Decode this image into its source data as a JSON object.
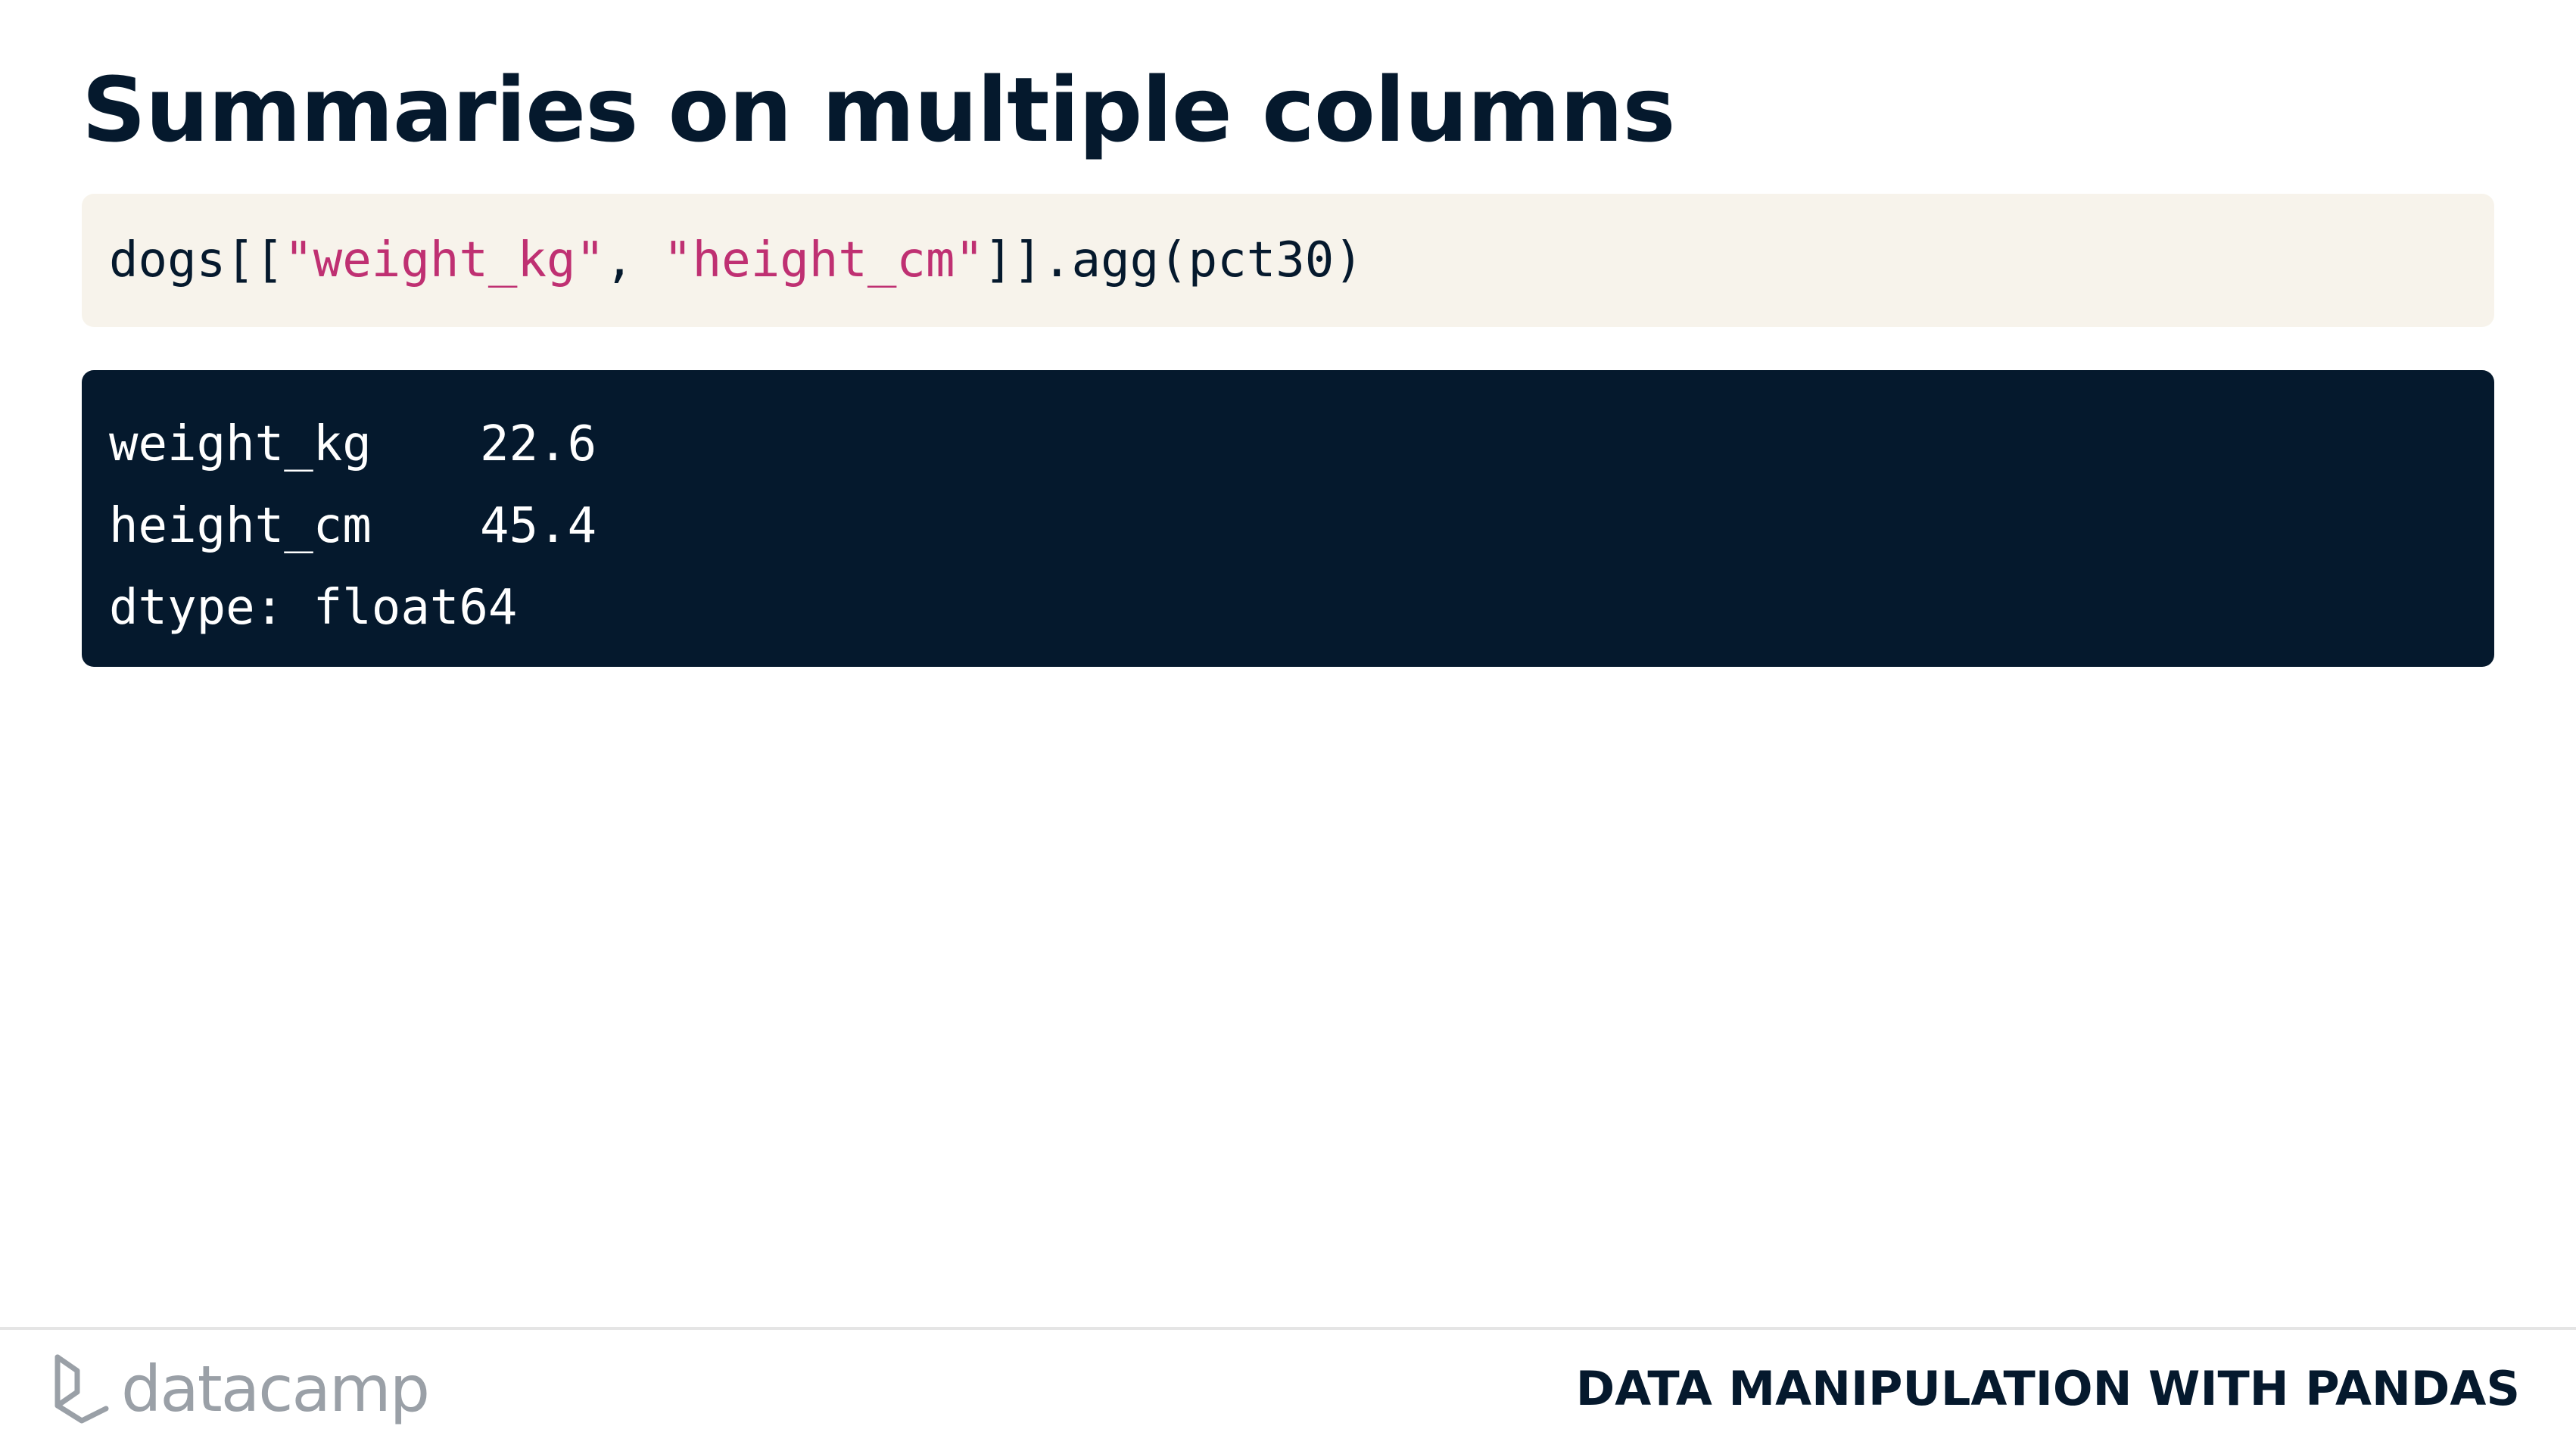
{
  "slide": {
    "title": "Summaries on multiple columns"
  },
  "code": {
    "prefix": "dogs[[",
    "string1": "\"weight_kg\"",
    "separator": ", ",
    "string2": "\"height_cm\"",
    "suffix": "]].agg(pct30)"
  },
  "output": {
    "rows": [
      {
        "key": "weight_kg",
        "value": "22.6"
      },
      {
        "key": "height_cm",
        "value": "45.4"
      }
    ],
    "dtype_line": "dtype: float64"
  },
  "footer": {
    "logo_text": "datacamp",
    "course_name": "DATA MANIPULATION WITH PANDAS"
  },
  "colors": {
    "title": "#05192d",
    "code_background": "#f7f3eb",
    "code_string": "#bf3072",
    "output_background": "#05192d",
    "output_text": "#ffffff",
    "logo": "#9aa0a7"
  }
}
